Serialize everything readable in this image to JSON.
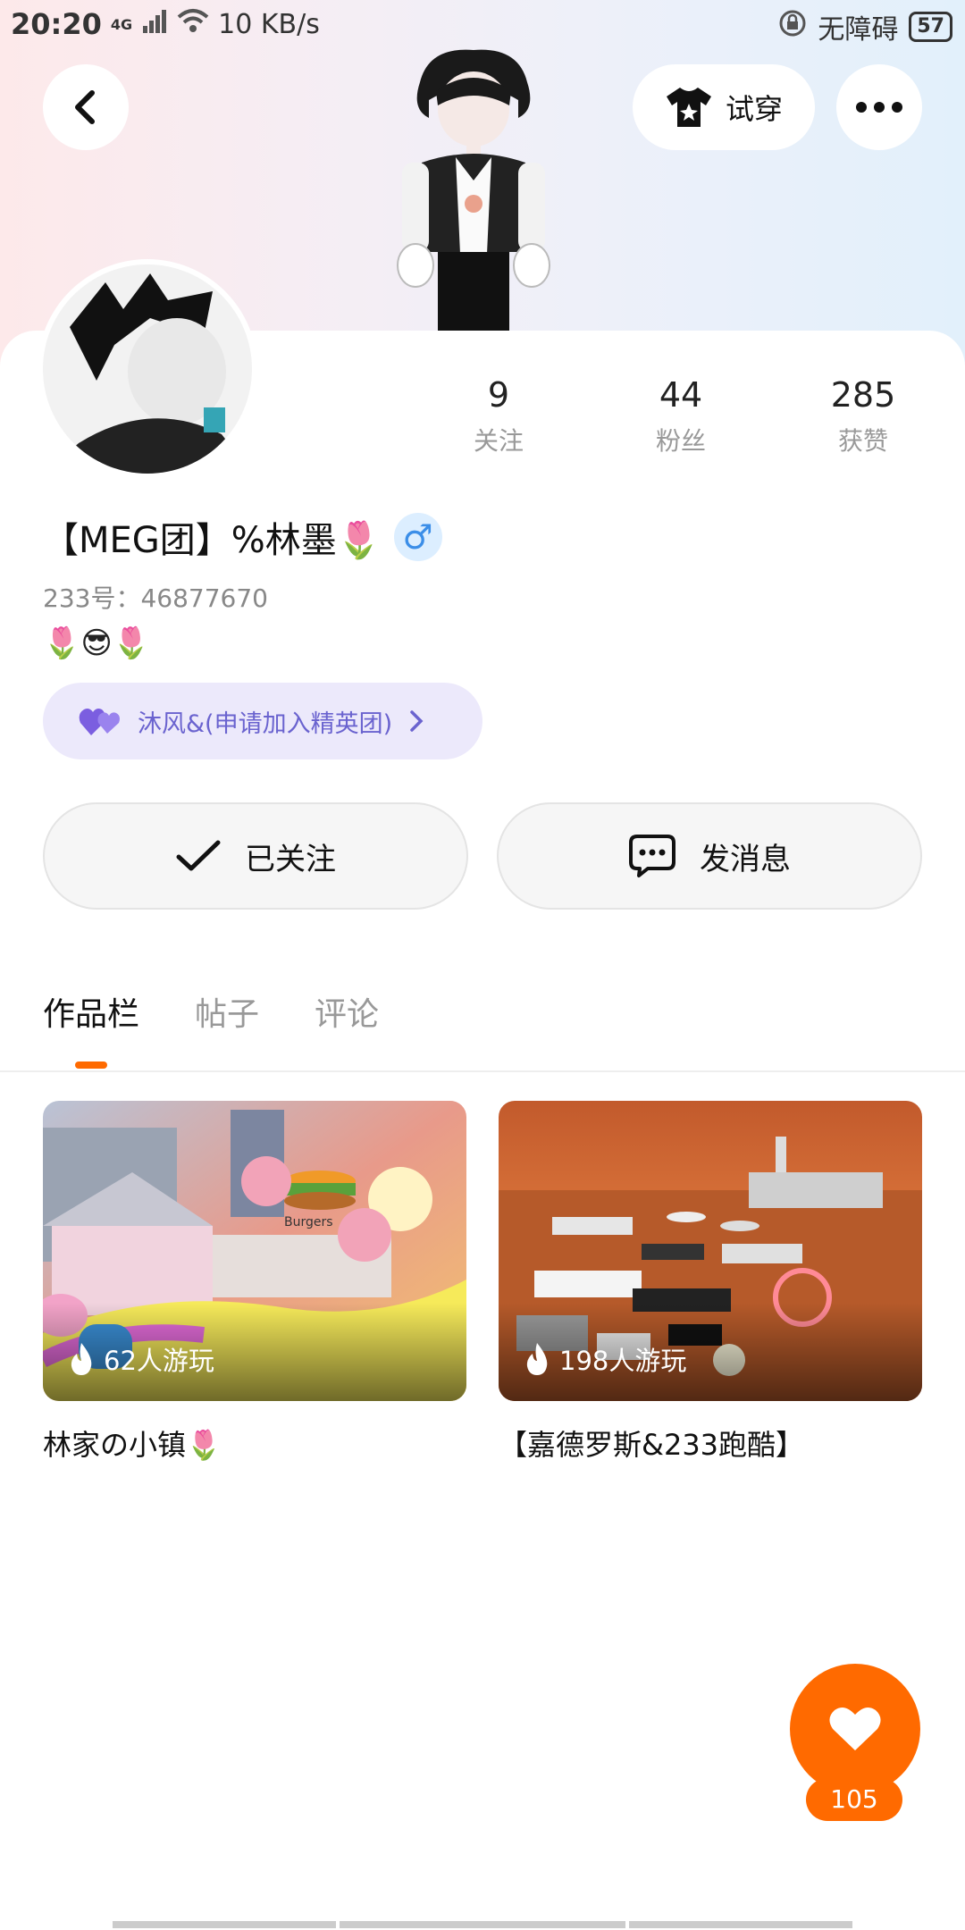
{
  "status_bar": {
    "time": "20:20",
    "network": "4G",
    "speed": "10 KB/s",
    "accessibility": "无障碍",
    "battery": "57"
  },
  "header": {
    "try_on_label": "试穿"
  },
  "profile": {
    "stats": [
      {
        "value": "9",
        "label": "关注"
      },
      {
        "value": "44",
        "label": "粉丝"
      },
      {
        "value": "285",
        "label": "获赞"
      }
    ],
    "nickname": "【MEG团】%林墨🌷",
    "gender_symbol": "♂",
    "uid": "233号：46877670",
    "bio": "🌷😎🌷",
    "family_label": "沐风&(申请加入精英团)"
  },
  "actions": {
    "followed_label": "已关注",
    "message_label": "发消息"
  },
  "tabs": [
    {
      "label": "作品栏",
      "active": true
    },
    {
      "label": "帖子",
      "active": false
    },
    {
      "label": "评论",
      "active": false
    }
  ],
  "works": [
    {
      "plays": "62人游玩",
      "title": "林家の小镇🌷",
      "thumb_text": "Burgers"
    },
    {
      "plays": "198人游玩",
      "title": "【嘉德罗斯&233跑酷】"
    }
  ],
  "like": {
    "count": "105"
  },
  "colors": {
    "accent": "#ff6a00",
    "family_pill_bg": "#ece9fb",
    "family_text": "#6a63cf",
    "gender_blue": "#3b8ee8"
  }
}
